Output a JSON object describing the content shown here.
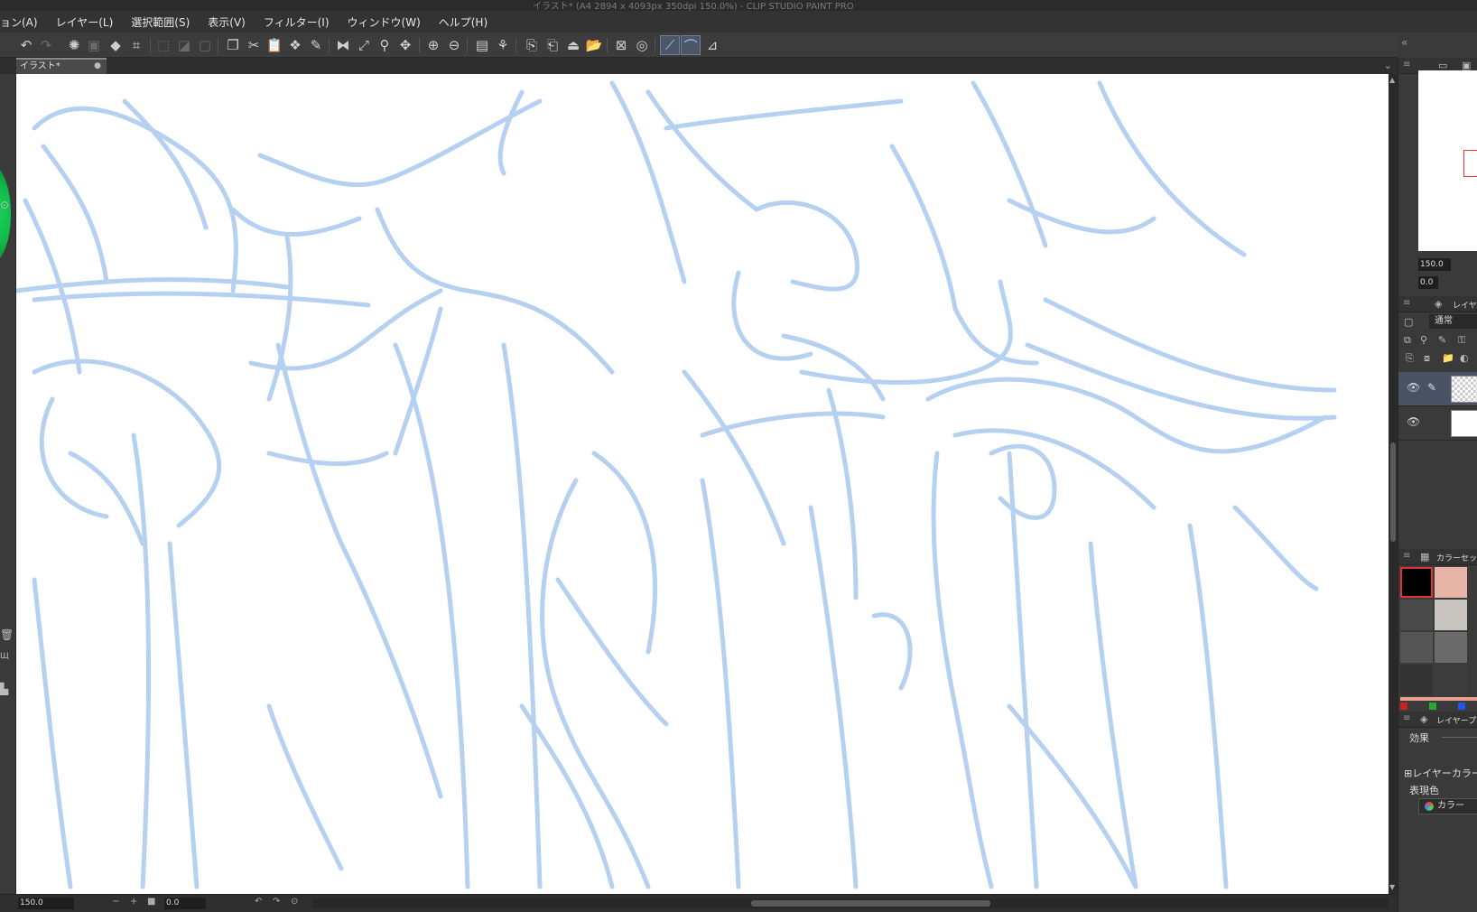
{
  "window": {
    "title": "イラスト* (A4 2894 x 4093px 350dpi 150.0%)  - CLIP STUDIO PAINT PRO"
  },
  "menu": [
    "ョン(A)",
    "レイヤー(L)",
    "選択範囲(S)",
    "表示(V)",
    "フィルター(I)",
    "ウィンドウ(W)",
    "ヘルプ(H)"
  ],
  "toolbar_icons": [
    "undo-icon",
    "redo-icon",
    "clear-icon",
    "clear-outside-icon",
    "fill-icon",
    "transform-icon",
    "deselect-icon",
    "invert-selection-icon",
    "mask-icon",
    "copy-icon",
    "cut-icon",
    "paste-icon",
    "layer-copy-icon",
    "edit-icon",
    "flip-horizontal-icon",
    "rotate-icon",
    "zoom-icon",
    "move-icon",
    "zoom-in-icon",
    "zoom-out-icon",
    "fit-icon",
    "snap-icon",
    "new-icon",
    "export-png-icon",
    "save-icon",
    "open-icon",
    "close-icon",
    "settings-icon",
    "ruler-snap-icon",
    "special-ruler-snap-icon",
    "grid-snap-icon"
  ],
  "tab": {
    "label": "イラスト*",
    "close_glyph": "●"
  },
  "statusbar": {
    "zoom": "150.0",
    "angle": "0.0"
  },
  "navigator": {
    "zoom": "150.0",
    "angle": "0.0"
  },
  "layer_panel": {
    "title": "レイヤー",
    "blend_mode": "通常"
  },
  "color_panel": {
    "title": "カラーセット",
    "swatches": [
      [
        "#000000",
        "#e8b4a6"
      ],
      [
        "#4a4a4a",
        "#c8c4c0"
      ],
      [
        "#555555",
        "#6a6a6a"
      ],
      [
        "#333333",
        "#3c3c3c"
      ]
    ],
    "strip_colors": [
      "#cc2222",
      "#22aa33",
      "#2255ee"
    ]
  },
  "layer_property": {
    "title": "レイヤープロパティ",
    "effect": "効果",
    "layer_color": "レイヤーカラー",
    "express_color": "表現色",
    "color_button": "カラー"
  },
  "colors": {
    "sketch_line": "#b5d0f0",
    "accent_selection": "#4a5366"
  }
}
